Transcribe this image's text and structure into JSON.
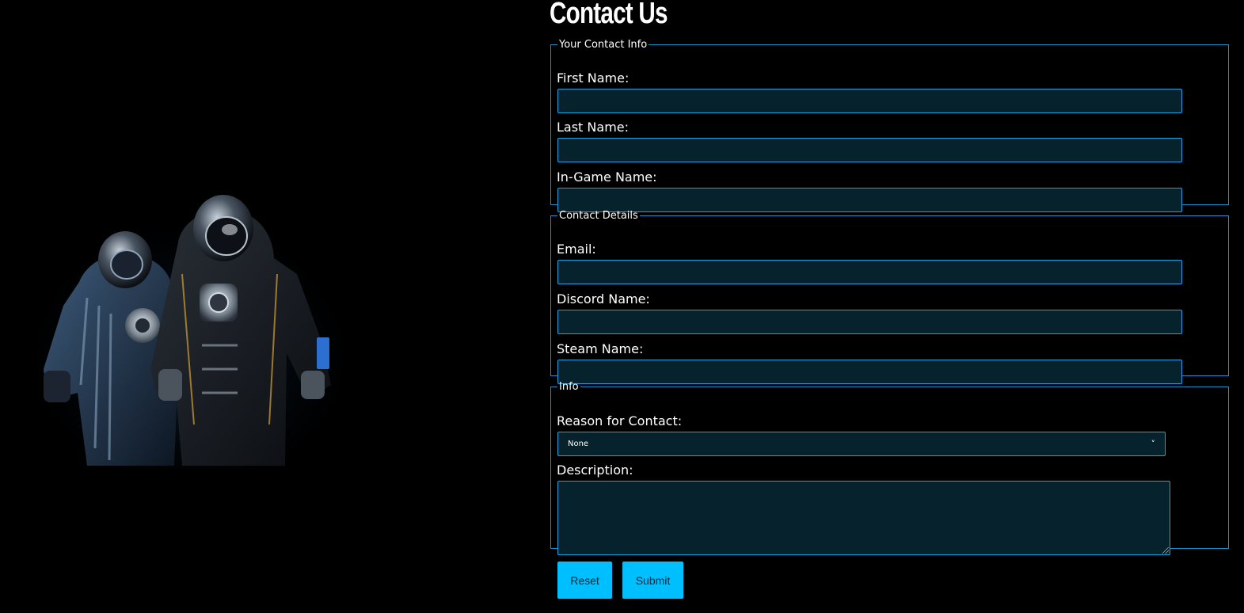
{
  "page": {
    "title": "Contact Us"
  },
  "sections": {
    "contact_info": {
      "legend": "Your Contact Info",
      "first_name_label": "First Name:",
      "first_name_value": "",
      "last_name_label": "Last Name:",
      "last_name_value": "",
      "ingame_name_label": "In-Game Name:",
      "ingame_name_value": ""
    },
    "contact_details": {
      "legend": "Contact Details",
      "email_label": "Email:",
      "email_value": "",
      "discord_label": "Discord Name:",
      "discord_value": "",
      "steam_label": "Steam Name:",
      "steam_value": ""
    },
    "info": {
      "legend": "Info",
      "reason_label": "Reason for Contact:",
      "reason_selected": "None",
      "description_label": "Description:",
      "description_value": ""
    }
  },
  "buttons": {
    "reset": "Reset",
    "submit": "Submit"
  },
  "icons": {
    "select_arrow": "chevron-down-icon",
    "resize_handle": "resize-grip-icon"
  },
  "colors": {
    "background": "#000000",
    "field_background": "#06222d",
    "field_border": "#1aa3e0",
    "fieldset_border": "#1b8fc9",
    "button_background": "#00bfff",
    "text": "#ffffff"
  }
}
